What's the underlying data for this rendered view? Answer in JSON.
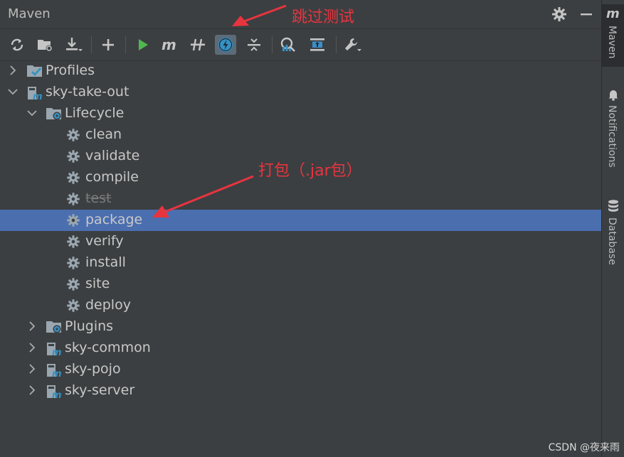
{
  "panel": {
    "title": "Maven"
  },
  "header_buttons": [
    {
      "name": "settings",
      "icon": "gear-icon"
    },
    {
      "name": "hide",
      "icon": "minus-icon"
    }
  ],
  "toolbar": [
    {
      "icon": "reload-icon"
    },
    {
      "icon": "folder-sync-icon"
    },
    {
      "icon": "download-icon"
    },
    {
      "icon": "plus-icon"
    },
    {
      "icon": "run-icon"
    },
    {
      "icon": "maven-m-icon"
    },
    {
      "icon": "toggle-offline-icon"
    },
    {
      "icon": "skip-tests-icon",
      "active": true
    },
    {
      "icon": "collapse-icon"
    },
    {
      "icon": "analyze-dependencies-icon"
    },
    {
      "icon": "show-diagram-icon"
    },
    {
      "icon": "wrench-icon"
    }
  ],
  "tree": [
    {
      "label": "Profiles",
      "level": 0,
      "arrow": "right",
      "icon": "profiles-icon"
    },
    {
      "label": "sky-take-out",
      "level": 0,
      "arrow": "down",
      "icon": "maven-module-icon"
    },
    {
      "label": "Lifecycle",
      "level": 1,
      "arrow": "down",
      "icon": "lifecycle-folder-icon"
    },
    {
      "label": "clean",
      "level": 2,
      "icon": "gear-icon"
    },
    {
      "label": "validate",
      "level": 2,
      "icon": "gear-icon"
    },
    {
      "label": "compile",
      "level": 2,
      "icon": "gear-icon"
    },
    {
      "label": "test",
      "level": 2,
      "icon": "gear-icon",
      "strike": true
    },
    {
      "label": "package",
      "level": 2,
      "icon": "gear-icon",
      "selected": true
    },
    {
      "label": "verify",
      "level": 2,
      "icon": "gear-icon"
    },
    {
      "label": "install",
      "level": 2,
      "icon": "gear-icon"
    },
    {
      "label": "site",
      "level": 2,
      "icon": "gear-icon"
    },
    {
      "label": "deploy",
      "level": 2,
      "icon": "gear-icon"
    },
    {
      "label": "Plugins",
      "level": 1,
      "arrow": "right",
      "icon": "plugins-folder-icon"
    },
    {
      "label": "sky-common",
      "level": 1,
      "arrow": "right",
      "icon": "maven-module-icon"
    },
    {
      "label": "sky-pojo",
      "level": 1,
      "arrow": "right",
      "icon": "maven-module-icon"
    },
    {
      "label": "sky-server",
      "level": 1,
      "arrow": "right",
      "icon": "maven-module-icon"
    }
  ],
  "side_tabs": [
    {
      "label": "Maven",
      "icon": "maven-m-icon",
      "active": true
    },
    {
      "label": "Notifications",
      "icon": "bell-icon"
    },
    {
      "label": "Database",
      "icon": "database-icon"
    }
  ],
  "annotations": {
    "skip_tests": "跳过测试",
    "package": "打包（.jar包）",
    "color": "#e8343f"
  },
  "watermark": "CSDN @夜来雨"
}
